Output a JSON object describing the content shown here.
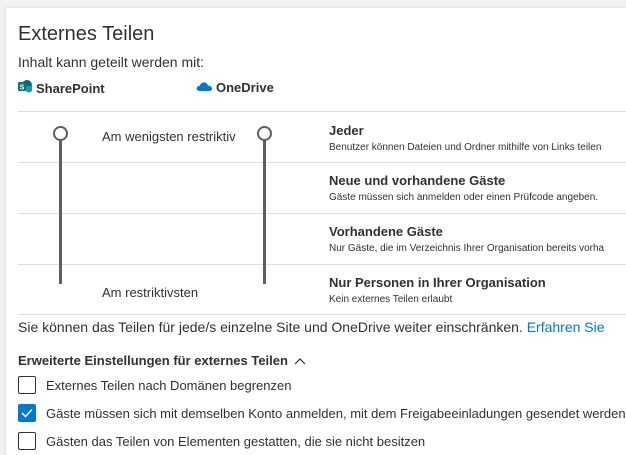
{
  "header": {
    "title": "Externes Teilen",
    "subtitle": "Inhalt kann geteilt werden mit:",
    "sharepoint_label": "SharePoint",
    "onedrive_label": "OneDrive"
  },
  "slider": {
    "top_label": "Am wenigsten restriktiv",
    "bottom_label": "Am restriktivsten",
    "sharepoint_level": "Jeder",
    "onedrive_level": "Jeder"
  },
  "levels": [
    {
      "name": "Jeder",
      "description": "Benutzer können Dateien und Ordner mithilfe von Links teilen"
    },
    {
      "name": "Neue und vorhandene Gäste",
      "description": "Gäste müssen sich anmelden oder einen Prüfcode angeben."
    },
    {
      "name": "Vorhandene Gäste",
      "description": "Nur Gäste, die im Verzeichnis Ihrer Organisation bereits vorha"
    },
    {
      "name": "Nur Personen in Ihrer Organisation",
      "description": "Kein externes Teilen erlaubt"
    }
  ],
  "info": {
    "text": "Sie können das Teilen für jede/s einzelne Site und OneDrive weiter einschränken. ",
    "link": "Erfahren Sie"
  },
  "advanced": {
    "label": "Erweiterte Einstellungen für externes Teilen",
    "options": [
      {
        "label": "Externes Teilen nach Domänen begrenzen",
        "checked": false
      },
      {
        "label": "Gäste müssen sich mit demselben Konto anmelden, mit dem Freigabeeinladungen gesendet werden.",
        "checked": true
      },
      {
        "label": "Gästen das Teilen von Elementen gestatten, die sie nicht besitzen",
        "checked": false
      }
    ]
  },
  "colors": {
    "accent": "#0078d4",
    "sharepoint": "#036c70",
    "onedrive": "#0078d4",
    "track": "#605e5c"
  },
  "icons": {
    "sharepoint": "sharepoint-logo-icon",
    "onedrive": "onedrive-cloud-icon",
    "collapse": "chevron-up-icon",
    "check": "checkmark-icon"
  }
}
